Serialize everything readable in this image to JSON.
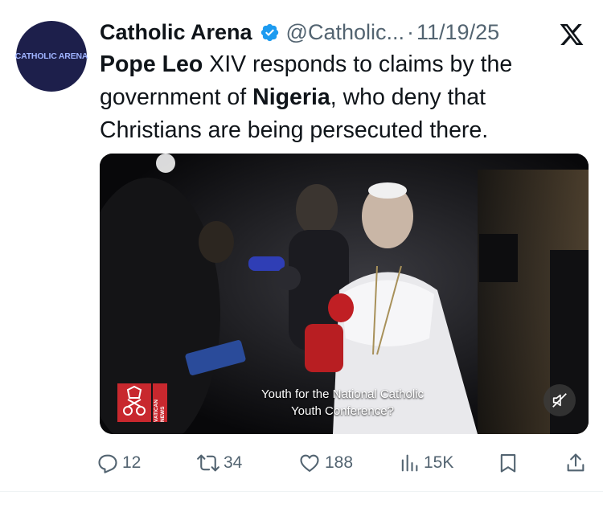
{
  "avatar": {
    "text": "CATHOLIC ARENA"
  },
  "header": {
    "author_name": "Catholic Arena",
    "handle": "@Catholic...",
    "separator": "·",
    "date": "11/19/25",
    "verified_color": "#1d9bf0"
  },
  "tweet": {
    "part1_bold": "Pope Leo",
    "part2": " XIV responds to claims by the government of ",
    "part3_bold": "Nigeria",
    "part4": ", who deny that Christians are being persecuted there."
  },
  "media": {
    "subtitle_line1": "Youth for the National Catholic",
    "subtitle_line2": "Youth Conference?",
    "logo_side_text": "VATICAN NEWS"
  },
  "actions": {
    "replies": "12",
    "reposts": "34",
    "likes": "188",
    "views": "15K"
  },
  "colors": {
    "muted_text": "#536471",
    "logo_red": "#c8282e"
  }
}
